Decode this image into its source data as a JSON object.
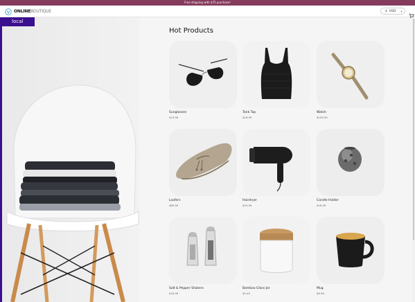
{
  "promo": {
    "text": "Free shipping with $75 purchase!"
  },
  "header": {
    "logo_online": "ONLINE",
    "logo_boutique": "BOUTIQUE",
    "currency_symbol": "$",
    "currency_code": "USD",
    "cart_icon": "cart-icon",
    "logo_icon": "boutique-logo-icon"
  },
  "hero": {
    "cluster_label": "local",
    "accent_color": "#3a0f8f"
  },
  "main": {
    "title": "Hot Products",
    "products": [
      {
        "name": "Sunglasses",
        "price": "$19.99"
      },
      {
        "name": "Tank Top",
        "price": "$18.99"
      },
      {
        "name": "Watch",
        "price": "$109.99"
      },
      {
        "name": "Loafers",
        "price": "$89.99"
      },
      {
        "name": "Hairdryer",
        "price": "$24.99"
      },
      {
        "name": "Candle Holder",
        "price": "$18.99"
      },
      {
        "name": "Salt & Pepper Shakers",
        "price": "$18.49"
      },
      {
        "name": "Bamboo Glass Jar",
        "price": "$5.49"
      },
      {
        "name": "Mug",
        "price": "$8.99"
      }
    ]
  },
  "colors": {
    "promo_bar": "#853b5c",
    "accent": "#3a0f8f"
  }
}
